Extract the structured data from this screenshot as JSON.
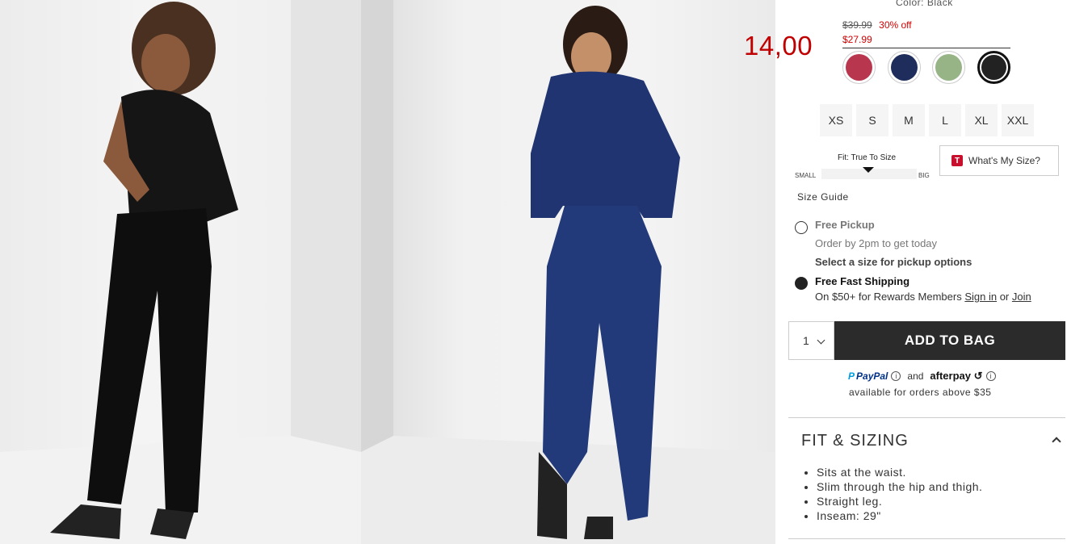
{
  "product": {
    "color_label": "Color: Black",
    "original_price": "$39.99",
    "discount": "30% off",
    "sale_price": "$27.99",
    "overlay_price": "14,00"
  },
  "swatches": [
    {
      "name": "red",
      "color": "#b8374f",
      "selected": false
    },
    {
      "name": "navy",
      "color": "#1e2d5c",
      "selected": false
    },
    {
      "name": "green",
      "color": "#96b486",
      "selected": false
    },
    {
      "name": "black",
      "color": "#222222",
      "selected": true
    }
  ],
  "sizes": [
    "XS",
    "S",
    "M",
    "L",
    "XL",
    "XXL"
  ],
  "fit": {
    "title": "Fit: True To Size",
    "small_label": "SMALL",
    "big_label": "BIG"
  },
  "whats_my_size": {
    "icon_letter": "T",
    "label": "What's My Size?"
  },
  "size_guide": "Size Guide",
  "fulfillment": {
    "pickup_title": "Free Pickup",
    "pickup_sub": "Order by 2pm to get today",
    "pickup_note": "Select a size for pickup options",
    "ship_title": "Free Fast Shipping",
    "ship_sub_prefix": "On $50+ for Rewards Members ",
    "sign_in": "Sign in",
    "or": " or ",
    "join": "Join"
  },
  "cart": {
    "quantity": "1",
    "add_label": "ADD TO BAG"
  },
  "payments": {
    "paypal": "PayPal",
    "and": "and",
    "afterpay": "afterpay",
    "note": "available for orders above $35"
  },
  "fit_sizing": {
    "title": "FIT & SIZING",
    "items": [
      "Sits at the waist.",
      "Slim through the hip and thigh.",
      "Straight leg.",
      "Inseam: 29\""
    ]
  },
  "colors": {
    "accent_red": "#d00000",
    "button_dark": "#2b2b2b"
  }
}
